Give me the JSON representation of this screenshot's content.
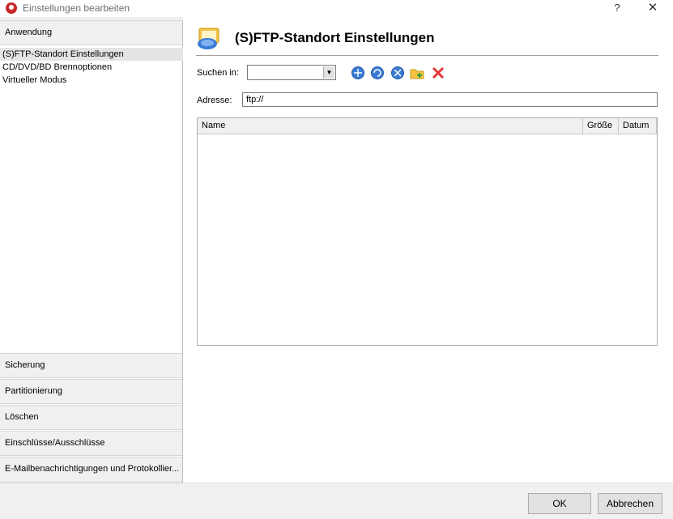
{
  "window": {
    "title": "Einstellungen bearbeiten",
    "help": "?",
    "close": "✕"
  },
  "sidebar": {
    "top_section": "Anwendung",
    "items": [
      {
        "label": "(S)FTP-Standort Einstellungen",
        "selected": true
      },
      {
        "label": "CD/DVD/BD Brennoptionen",
        "selected": false
      },
      {
        "label": "Virtueller Modus",
        "selected": false
      }
    ],
    "sections": [
      "Sicherung",
      "Partitionierung",
      "Löschen",
      "Einschlüsse/Ausschlüsse",
      "E-Mailbenachrichtigungen und Protokollier..."
    ]
  },
  "main": {
    "title": "(S)FTP-Standort Einstellungen",
    "look_in_label": "Suchen in:",
    "look_in_value": "",
    "toolbar_icons": [
      "connect-icon",
      "refresh-icon",
      "disconnect-icon",
      "new-folder-icon",
      "delete-icon"
    ],
    "address_label": "Adresse:",
    "address_value": "ftp://",
    "columns": [
      "Name",
      "Größe",
      "Datum"
    ]
  },
  "footer": {
    "ok": "OK",
    "cancel": "Abbrechen"
  },
  "colors": {
    "accent": "#3a7bd5",
    "delete": "#e53935",
    "folder": "#f5c242"
  }
}
